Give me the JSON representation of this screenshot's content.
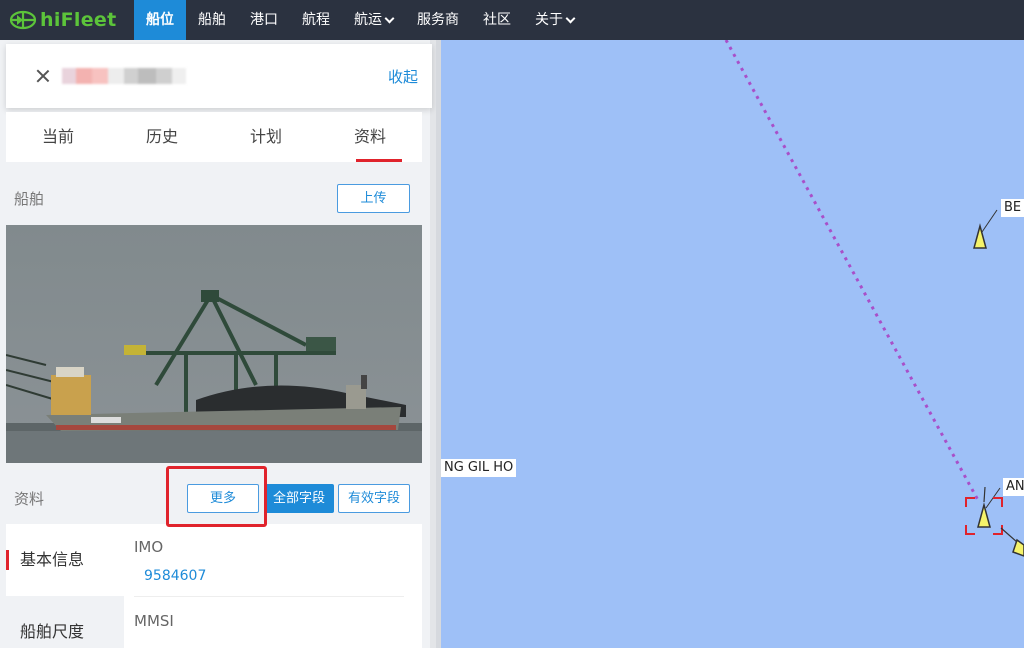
{
  "topbar": {
    "logo_text": "hiFleet",
    "nav": [
      {
        "label": "船位",
        "active": true,
        "dropdown": false
      },
      {
        "label": "船舶",
        "active": false,
        "dropdown": false
      },
      {
        "label": "港口",
        "active": false,
        "dropdown": false
      },
      {
        "label": "航程",
        "active": false,
        "dropdown": false
      },
      {
        "label": "航运",
        "active": false,
        "dropdown": true
      },
      {
        "label": "服务商",
        "active": false,
        "dropdown": false
      },
      {
        "label": "社区",
        "active": false,
        "dropdown": false
      },
      {
        "label": "关于",
        "active": false,
        "dropdown": true
      }
    ]
  },
  "panel": {
    "collapse_label": "收起",
    "tabs": [
      {
        "label": "当前",
        "active": false
      },
      {
        "label": "历史",
        "active": false
      },
      {
        "label": "计划",
        "active": false
      },
      {
        "label": "资料",
        "active": true
      }
    ],
    "ship_section": {
      "title": "船舶",
      "upload_label": "上传"
    },
    "data_section": {
      "title": "资料",
      "more_label": "更多",
      "all_fields_label": "全部字段",
      "valid_fields_label": "有效字段"
    },
    "side_menu": [
      {
        "label": "基本信息",
        "active": true
      },
      {
        "label": "船舶尺度",
        "active": false
      }
    ],
    "fields": [
      {
        "label": "IMO",
        "value": "9584607"
      },
      {
        "label": "MMSI",
        "value": ""
      }
    ]
  },
  "map": {
    "labels": {
      "left": "NG GIL HO",
      "top_right": "BE",
      "mid_right": "AN"
    },
    "colors": {
      "sea": "#9ec0f7",
      "route": "#a84fc9",
      "vessel": "#f5f36a",
      "selected": "#e0232c"
    }
  },
  "colors": {
    "accent": "#1e8bd8",
    "topbar": "#2b3240",
    "logo": "#5cc43a",
    "highlight": "#e0232c"
  }
}
